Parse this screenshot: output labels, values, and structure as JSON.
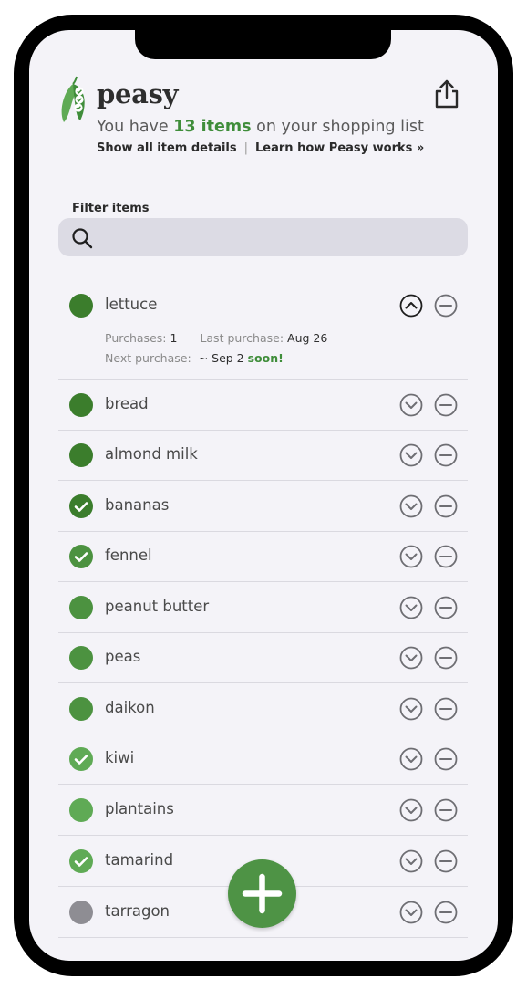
{
  "app": {
    "name": "peasy",
    "subtitle_prefix": "You have ",
    "item_count": "13 items",
    "subtitle_suffix": " on your shopping list",
    "show_details_link": "Show all item details",
    "separator": "|",
    "learn_link": "Learn how Peasy works »"
  },
  "icons": {
    "logo": "pea-pod-logo",
    "share": "share-icon",
    "search": "search-icon",
    "expand": "chevron-down-icon",
    "collapse": "chevron-up-icon",
    "remove": "minus-circle-icon",
    "add": "plus-icon"
  },
  "colors": {
    "accent": "#3f8d3a",
    "dark_green": "#3b7d2c",
    "medium_green": "#4c9240",
    "light_green": "#5faa55",
    "gray": "#8e8d93",
    "background": "#f4f3f8"
  },
  "filter": {
    "label": "Filter items",
    "value": "",
    "placeholder": ""
  },
  "items": [
    {
      "name": "lettuce",
      "checked": false,
      "color": "#3b7d2c",
      "expanded": true,
      "purchases_label": "Purchases:",
      "purchases": "1",
      "last_label": "Last purchase:",
      "last": "Aug 26",
      "next_label": "Next purchase:",
      "next": "~ Sep 2",
      "next_flag": "soon!"
    },
    {
      "name": "bread",
      "checked": false,
      "color": "#3b7d2c"
    },
    {
      "name": "almond milk",
      "checked": false,
      "color": "#3b7d2c"
    },
    {
      "name": "bananas",
      "checked": true,
      "color": "#3b7d2c"
    },
    {
      "name": "fennel",
      "checked": true,
      "color": "#4c9240"
    },
    {
      "name": "peanut butter",
      "checked": false,
      "color": "#4c9240"
    },
    {
      "name": "peas",
      "checked": false,
      "color": "#4c9240"
    },
    {
      "name": "daikon",
      "checked": false,
      "color": "#4c9240"
    },
    {
      "name": "kiwi",
      "checked": true,
      "color": "#5faa55"
    },
    {
      "name": "plantains",
      "checked": false,
      "color": "#5faa55"
    },
    {
      "name": "tamarind",
      "checked": true,
      "color": "#5faa55"
    },
    {
      "name": "tarragon",
      "checked": false,
      "color": "#8e8d93"
    }
  ]
}
